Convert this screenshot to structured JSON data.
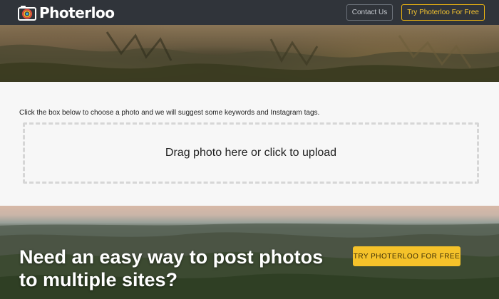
{
  "header": {
    "brand": "Photerloo",
    "contact_label": "Contact Us",
    "try_label": "Try Photerloo For Free"
  },
  "upload": {
    "instructions": "Click the box below to choose a photo and we will suggest some keywords and Instagram tags.",
    "dropzone_label": "Drag photo here or click to upload"
  },
  "promo": {
    "tagline": "Need an easy way to post photos to multiple sites?",
    "cta_label": "TRY PHOTERLOO FOR FREE"
  },
  "icons": {
    "logo": "camera-logo-icon"
  },
  "colors": {
    "header_bg": "#30343a",
    "accent": "#f5c22a",
    "page_bg": "#f7f7f7"
  }
}
